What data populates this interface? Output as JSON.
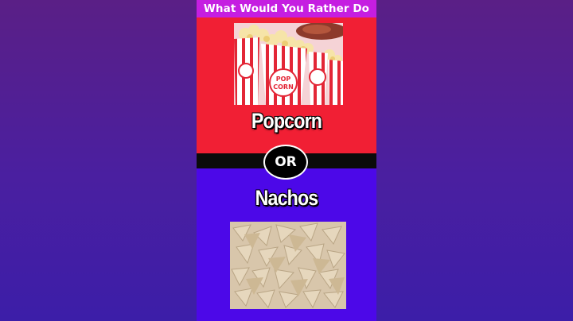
{
  "title": "What Would You Rather Do",
  "options": [
    {
      "label": "Popcorn",
      "image_icon": "popcorn-boxes-photo"
    },
    {
      "label": "Nachos",
      "image_icon": "tortilla-chips-photo"
    }
  ],
  "separator_text": "OR",
  "colors": {
    "background": "#4a1fa0",
    "title_bar": "#c51ee1",
    "top_panel": "#f11f34",
    "divider": "#0b0b0b",
    "bottom_panel": "#4c08e8"
  }
}
